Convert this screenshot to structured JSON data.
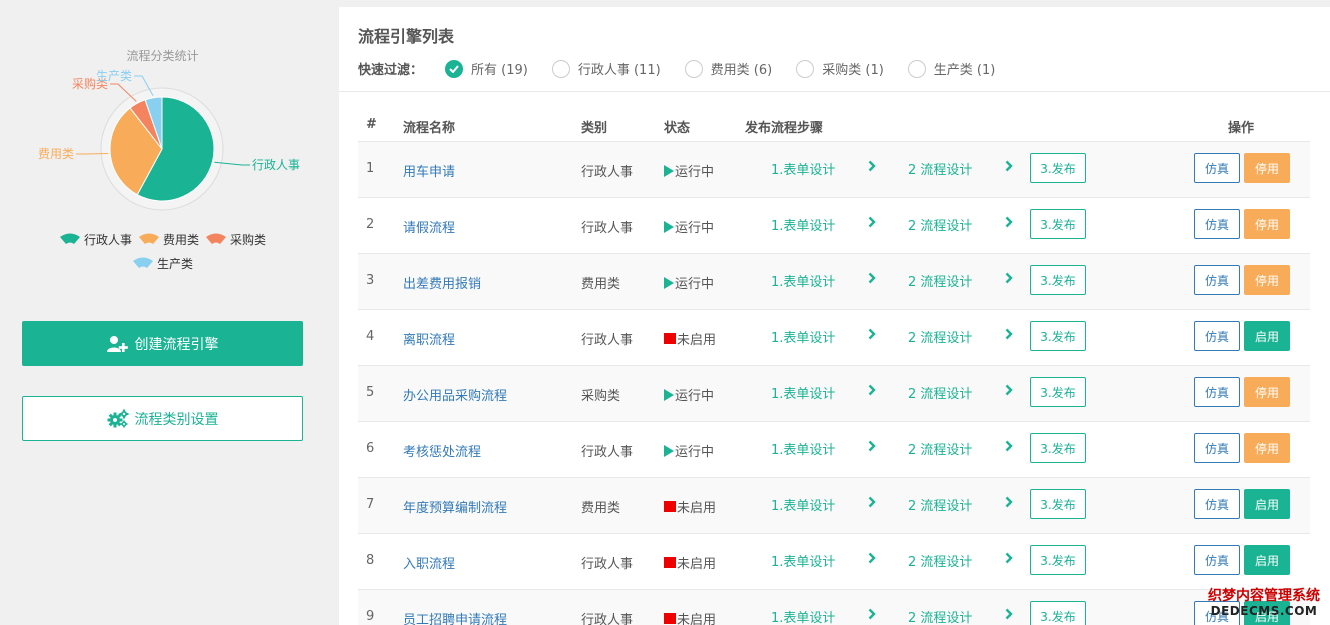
{
  "colors": {
    "accent": "#1ab394",
    "warning": "#f8ac59",
    "link": "#337ab7",
    "off": "#ee0000"
  },
  "chart_data": {
    "type": "pie",
    "title": "流程分类统计",
    "categories": [
      "行政人事",
      "费用类",
      "采购类",
      "生产类"
    ],
    "values": [
      11,
      6,
      1,
      1
    ],
    "colors": [
      "#1ab394",
      "#f8ac59",
      "#f4845f",
      "#89cff0"
    ],
    "legend": "bottom"
  },
  "sidebar": {
    "create_label": "创建流程引擎",
    "settings_label": "流程类别设置"
  },
  "main": {
    "title": "流程引擎列表",
    "filter_label": "快速过滤：",
    "filters": [
      {
        "label": "所有 (19)",
        "checked": true
      },
      {
        "label": "行政人事 (11)",
        "checked": false
      },
      {
        "label": "费用类 (6)",
        "checked": false
      },
      {
        "label": "采购类 (1)",
        "checked": false
      },
      {
        "label": "生产类 (1)",
        "checked": false
      }
    ],
    "columns": {
      "no": "#",
      "name": "流程名称",
      "category": "类别",
      "status": "状态",
      "steps": "发布流程步骤",
      "actions": "操作"
    },
    "step_labels": [
      "1.表单设计",
      "2 流程设计",
      "3.发布"
    ],
    "sim_label": "仿真",
    "rows": [
      {
        "no": "1",
        "name": "用车申请",
        "category": "行政人事",
        "status": "运行中",
        "running": true,
        "action": "停用"
      },
      {
        "no": "2",
        "name": "请假流程",
        "category": "行政人事",
        "status": "运行中",
        "running": true,
        "action": "停用"
      },
      {
        "no": "3",
        "name": "出差费用报销",
        "category": "费用类",
        "status": "运行中",
        "running": true,
        "action": "停用"
      },
      {
        "no": "4",
        "name": "离职流程",
        "category": "行政人事",
        "status": "未启用",
        "running": false,
        "action": "启用"
      },
      {
        "no": "5",
        "name": "办公用品采购流程",
        "category": "采购类",
        "status": "运行中",
        "running": true,
        "action": "停用"
      },
      {
        "no": "6",
        "name": "考核惩处流程",
        "category": "行政人事",
        "status": "运行中",
        "running": true,
        "action": "停用"
      },
      {
        "no": "7",
        "name": "年度预算编制流程",
        "category": "费用类",
        "status": "未启用",
        "running": false,
        "action": "启用"
      },
      {
        "no": "8",
        "name": "入职流程",
        "category": "行政人事",
        "status": "未启用",
        "running": false,
        "action": "启用"
      },
      {
        "no": "9",
        "name": "员工招聘申请流程",
        "category": "行政人事",
        "status": "未启用",
        "running": false,
        "action": "启用"
      }
    ]
  },
  "watermark": {
    "line1": "织梦内容管理系统",
    "line2": "DEDECMS.COM"
  }
}
